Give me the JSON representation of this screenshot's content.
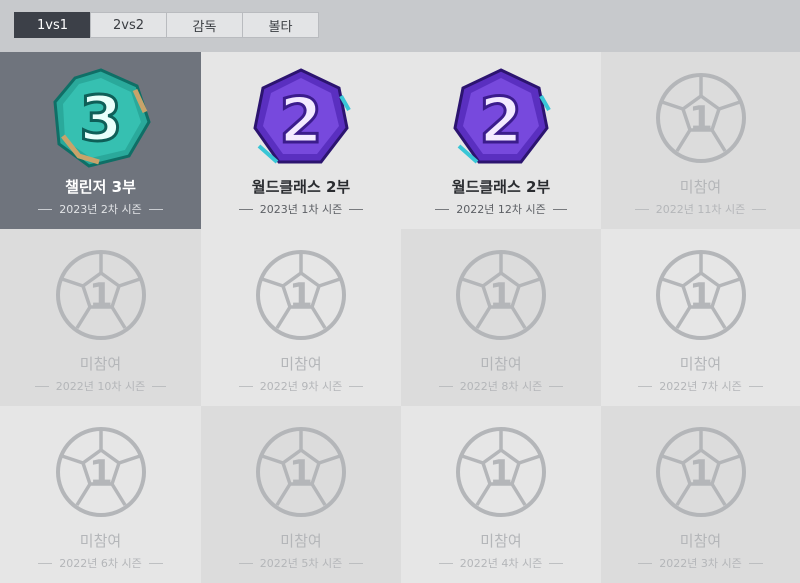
{
  "tabs": [
    {
      "label": "1vs1",
      "active": true
    },
    {
      "label": "2vs2",
      "active": false
    },
    {
      "label": "감독",
      "active": false
    },
    {
      "label": "볼타",
      "active": false
    }
  ],
  "seasons": [
    {
      "division": "챌린저 3부",
      "season": "2023년 2차 시즌",
      "rank_number": "3",
      "badge": "challenger-badge-icon",
      "state": "selected"
    },
    {
      "division": "월드클래스 2부",
      "season": "2023년 1차 시즌",
      "rank_number": "2",
      "badge": "world-class-badge-icon",
      "state": "participated"
    },
    {
      "division": "월드클래스 2부",
      "season": "2022년 12차 시즌",
      "rank_number": "2",
      "badge": "world-class-badge-icon",
      "state": "participated"
    },
    {
      "division": "미참여",
      "season": "2022년 11차 시즌",
      "rank_number": "1",
      "badge": "soccer-ball-icon",
      "state": "not-participated"
    },
    {
      "division": "미참여",
      "season": "2022년 10차 시즌",
      "rank_number": "1",
      "badge": "soccer-ball-icon",
      "state": "not-participated"
    },
    {
      "division": "미참여",
      "season": "2022년 9차 시즌",
      "rank_number": "1",
      "badge": "soccer-ball-icon",
      "state": "not-participated"
    },
    {
      "division": "미참여",
      "season": "2022년 8차 시즌",
      "rank_number": "1",
      "badge": "soccer-ball-icon",
      "state": "not-participated"
    },
    {
      "division": "미참여",
      "season": "2022년 7차 시즌",
      "rank_number": "1",
      "badge": "soccer-ball-icon",
      "state": "not-participated"
    },
    {
      "division": "미참여",
      "season": "2022년 6차 시즌",
      "rank_number": "1",
      "badge": "soccer-ball-icon",
      "state": "not-participated"
    },
    {
      "division": "미참여",
      "season": "2022년 5차 시즌",
      "rank_number": "1",
      "badge": "soccer-ball-icon",
      "state": "not-participated"
    },
    {
      "division": "미참여",
      "season": "2022년 4차 시즌",
      "rank_number": "1",
      "badge": "soccer-ball-icon",
      "state": "not-participated"
    },
    {
      "division": "미참여",
      "season": "2022년 3차 시즌",
      "rank_number": "1",
      "badge": "soccer-ball-icon",
      "state": "not-participated"
    }
  ],
  "colors": {
    "challenger_teal": "#1fb5a6",
    "world_class_purple": "#6a3fd1",
    "selected_cell": "#6f747d",
    "inactive_gray": "#b4b6b9"
  }
}
